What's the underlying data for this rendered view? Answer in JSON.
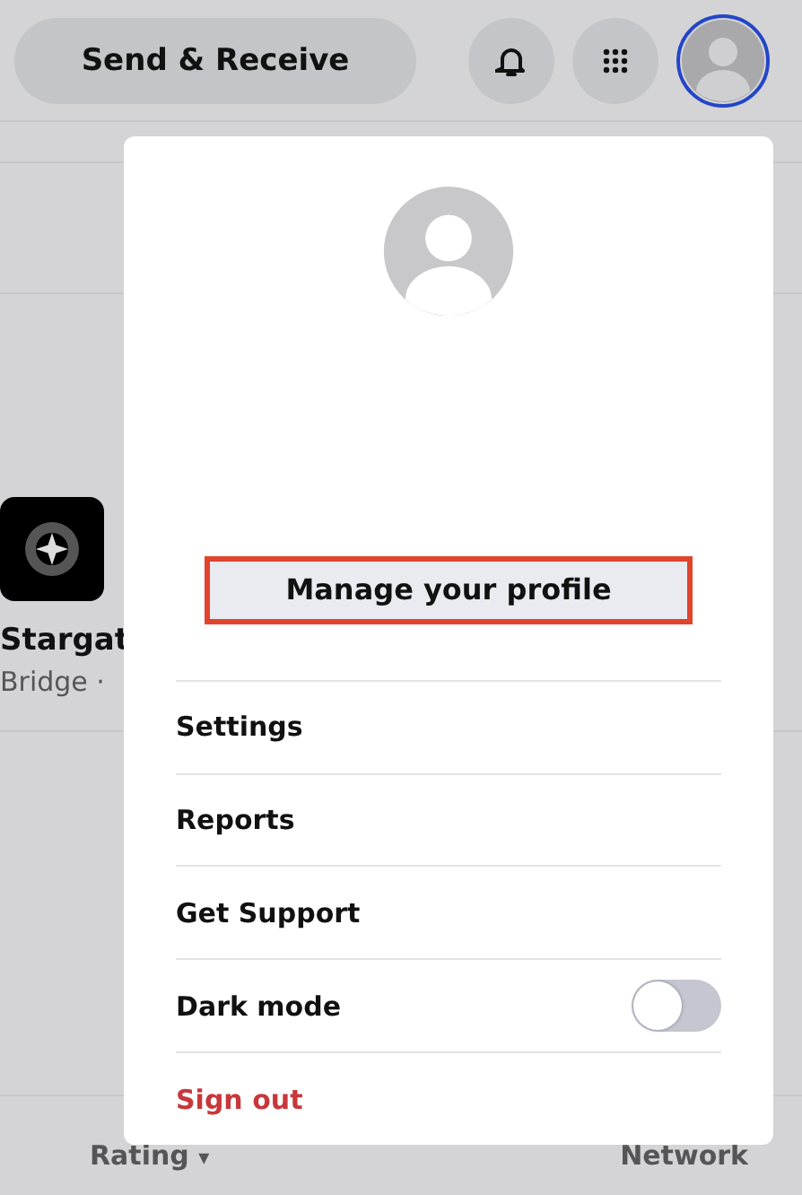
{
  "header": {
    "send_receive": "Send & Receive"
  },
  "list": {
    "item": {
      "name": "Stargat",
      "subtitle": "Bridge ·"
    }
  },
  "footer": {
    "sort": "Rating",
    "sort_caret": "▾",
    "column_2": "Network"
  },
  "profile_menu": {
    "manage_profile": {
      "label": "Manage your profile",
      "highlighted": true
    },
    "items": [
      {
        "kind": "link",
        "label": "Settings"
      },
      {
        "kind": "link",
        "label": "Reports"
      },
      {
        "kind": "link",
        "label": "Get Support"
      },
      {
        "kind": "toggle",
        "label": "Dark mode",
        "on": false
      },
      {
        "kind": "danger",
        "label": "Sign out"
      }
    ]
  }
}
